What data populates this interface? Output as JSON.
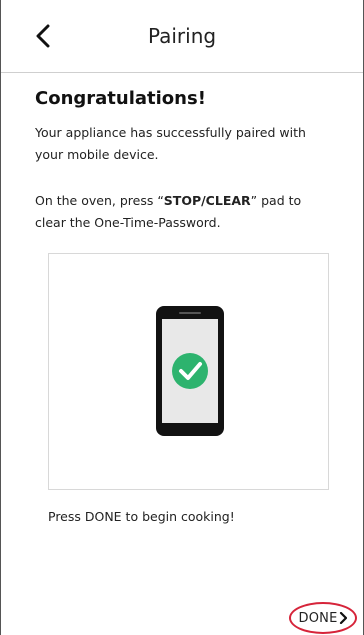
{
  "header": {
    "title": "Pairing",
    "back_icon": "chevron-left-icon"
  },
  "content": {
    "heading": "Congratulations!",
    "paragraph_1": "Your appliance has successfully paired with your mobile device.",
    "paragraph_2_prefix": "On the oven, press “",
    "paragraph_2_bold": "STOP/CLEAR",
    "paragraph_2_suffix": "” pad to clear the One-Time-Password.",
    "illustration_icon": "phone-check-icon",
    "footer_text": "Press DONE to begin cooking!"
  },
  "actions": {
    "done_label": "DONE",
    "done_icon": "chevron-right-icon"
  },
  "colors": {
    "check_green": "#2db36e",
    "highlight_red": "#d6243a",
    "phone_black": "#121212",
    "screen_gray": "#e8e8e8"
  }
}
